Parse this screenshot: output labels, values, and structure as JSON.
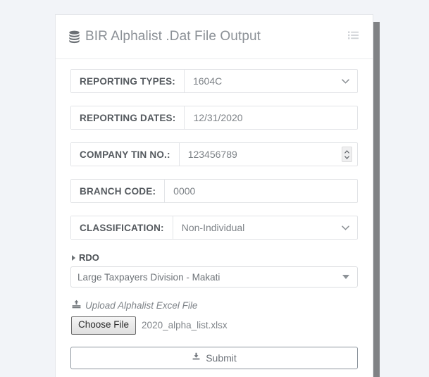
{
  "card": {
    "title": "BIR Alphalist .Dat File Output",
    "title_icon": "database-icon",
    "menu_icon": "list-icon"
  },
  "form": {
    "fields": [
      {
        "label": "REPORTING TYPES:",
        "value": "1604C",
        "control": "select",
        "name": "reporting-types"
      },
      {
        "label": "REPORTING DATES:",
        "value": "12/31/2020",
        "control": "text",
        "name": "reporting-dates"
      },
      {
        "label": "COMPANY TIN NO.:",
        "value": "123456789",
        "control": "number",
        "name": "company-tin-no"
      },
      {
        "label": "BRANCH CODE:",
        "value": "0000",
        "control": "text",
        "name": "branch-code"
      },
      {
        "label": "CLASSIFICATION:",
        "value": "Non-Individual",
        "control": "select",
        "name": "classification"
      }
    ],
    "rdo": {
      "label": "RDO",
      "selected": "Large Taxpayers Division - Makati",
      "caret_icon": "caret-right-icon",
      "dropdown_icon": "caret-down-icon"
    },
    "upload": {
      "label": "Upload Alphalist Excel File",
      "icon": "upload-icon",
      "choose_file_label": "Choose File",
      "file_name": "2020_alpha_list.xlsx"
    },
    "submit": {
      "label": "Submit",
      "icon": "download-icon"
    }
  },
  "colors": {
    "page_background": "#f2f4f8",
    "card_background": "#ffffff",
    "label_text": "#555a5f",
    "value_text": "#7d8287",
    "title_text": "#8b9096",
    "border": "#e2e4e7",
    "scrollbar_thumb": "#808285"
  }
}
